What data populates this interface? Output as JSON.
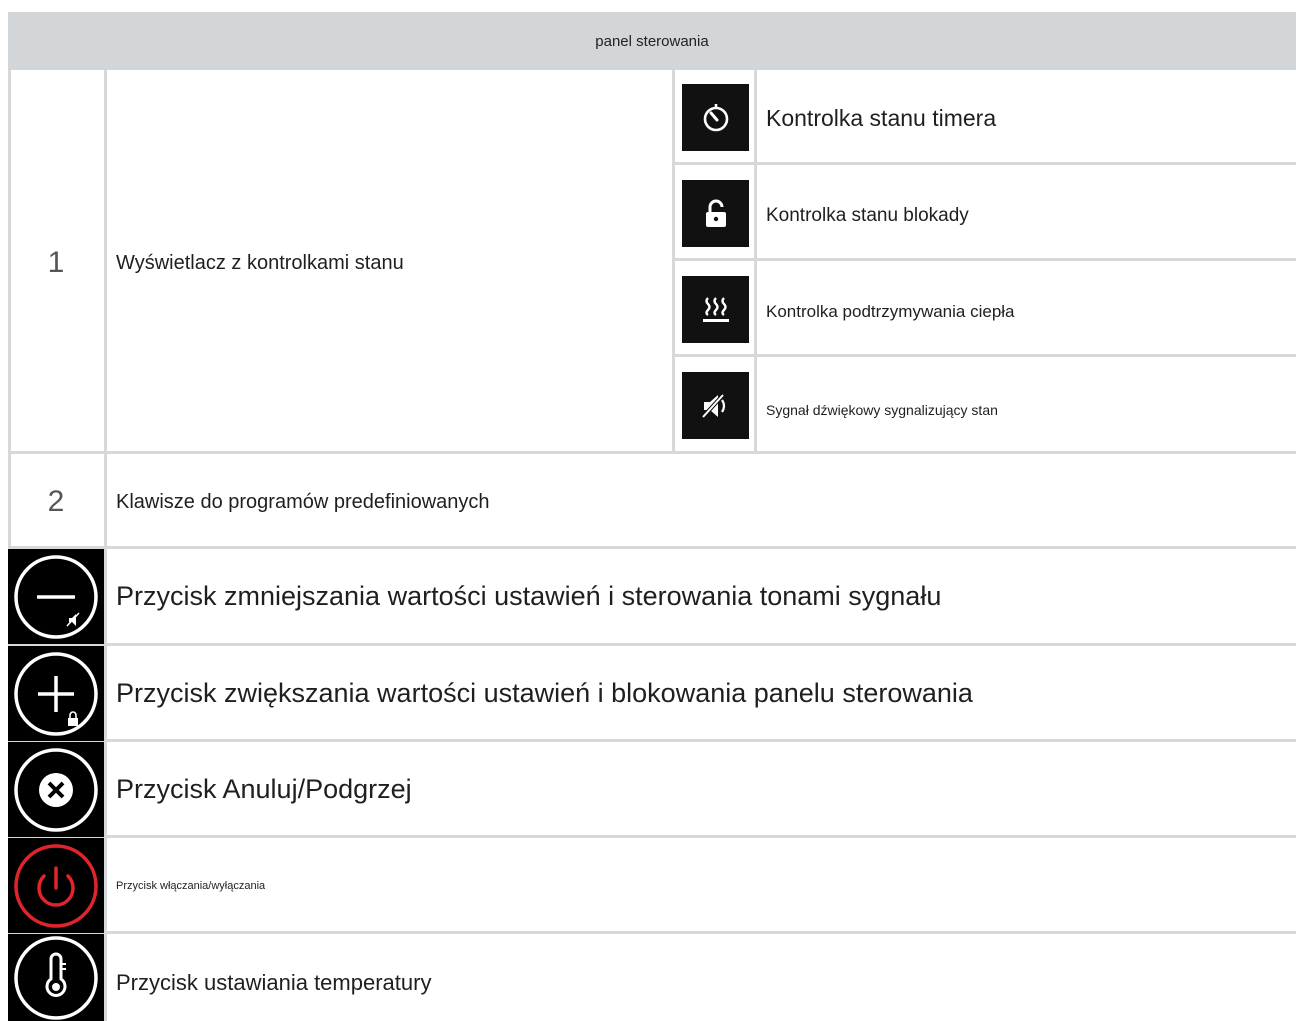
{
  "header": {
    "title": "panel sterowania"
  },
  "row1": {
    "number": "1",
    "label": "Wyświetlacz z kontrolkami stanu",
    "indicators": [
      {
        "icon": "timer-icon",
        "label": "Kontrolka stanu timera"
      },
      {
        "icon": "lock-icon",
        "label": "Kontrolka stanu blokady"
      },
      {
        "icon": "keep-warm-icon",
        "label": "Kontrolka podtrzymywania ciepła"
      },
      {
        "icon": "sound-off-icon",
        "label": "Sygnał dźwiękowy sygnalizujący stan"
      }
    ]
  },
  "row2": {
    "number": "2",
    "label": "Klawisze do programów predefiniowanych"
  },
  "buttons": [
    {
      "icon": "minus-sound-icon",
      "label": "Przycisk zmniejszania wartości ustawień i sterowania tonami sygnału"
    },
    {
      "icon": "plus-lock-icon",
      "label": "Przycisk zwiększania wartości ustawień i blokowania panelu sterowania"
    },
    {
      "icon": "cancel-icon",
      "label": "Przycisk Anuluj/Podgrzej"
    },
    {
      "icon": "power-icon",
      "label": "Przycisk włączania/wyłączania"
    },
    {
      "icon": "thermometer-icon",
      "label": "Przycisk ustawiania temperatury"
    }
  ],
  "colors": {
    "header_bg": "#d3d6d8",
    "icon_bg": "#111111",
    "power_red": "#e0242b",
    "grid_line": "#d6d8da"
  }
}
